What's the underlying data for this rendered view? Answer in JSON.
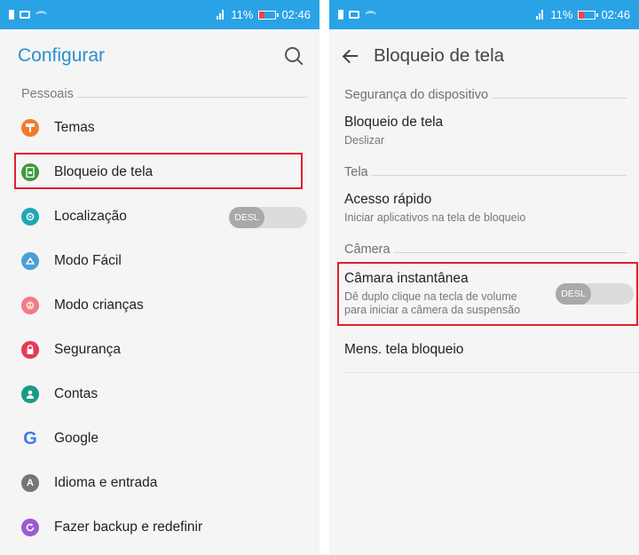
{
  "status_bar": {
    "battery_percent": "11%",
    "time": "02:46"
  },
  "left": {
    "title": "Configurar",
    "section": "Pessoais",
    "items": [
      {
        "label": "Temas",
        "icon": "paint-roller-icon",
        "color": "#f07b2c"
      },
      {
        "label": "Bloqueio de tela",
        "icon": "lock-screen-icon",
        "color": "#3e9a3a"
      },
      {
        "label": "Localização",
        "icon": "location-icon",
        "color": "#1ea8b8"
      },
      {
        "label": "Modo Fácil",
        "icon": "easy-mode-icon",
        "color": "#4a9fd8"
      },
      {
        "label": "Modo crianças",
        "icon": "kids-mode-icon",
        "color": "#f07a8a"
      },
      {
        "label": "Segurança",
        "icon": "padlock-icon",
        "color": "#e53a55"
      },
      {
        "label": "Contas",
        "icon": "account-icon",
        "color": "#1a9a86"
      },
      {
        "label": "Google",
        "icon": "google-icon",
        "color": "#3b7de0",
        "glyph": "G"
      },
      {
        "label": "Idioma e entrada",
        "icon": "language-icon",
        "color": "#757575",
        "glyph": "A"
      },
      {
        "label": "Fazer backup e redefinir",
        "icon": "backup-icon",
        "color": "#9b5bd2"
      }
    ],
    "location_toggle": "DESL"
  },
  "right": {
    "title": "Bloqueio de tela",
    "sections": [
      {
        "header": "Segurança do dispositivo",
        "items": [
          {
            "title": "Bloqueio de tela",
            "subtitle": "Deslizar"
          }
        ]
      },
      {
        "header": "Tela",
        "items": [
          {
            "title": "Acesso rápido",
            "subtitle": "Iniciar aplicativos na tela de bloqueio"
          }
        ]
      },
      {
        "header": "Câmera",
        "items": [
          {
            "title": "Câmara instantânea",
            "subtitle": "Dê duplo clique na tecla de volume para iniciar a câmera da suspensão",
            "toggle": "DESL"
          },
          {
            "title": "Mens. tela bloqueio"
          }
        ]
      }
    ]
  }
}
